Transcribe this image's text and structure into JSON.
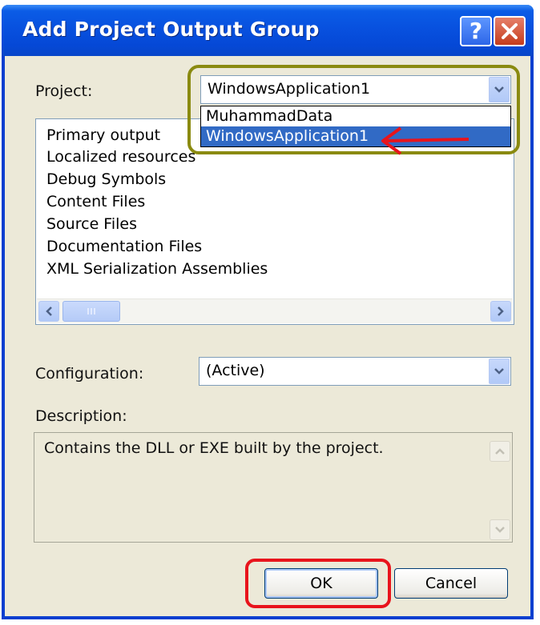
{
  "dialog": {
    "title": "Add Project Output Group",
    "help_symbol": "?",
    "close_symbol": "close"
  },
  "project": {
    "label": "Project:",
    "selected": "WindowsApplication1",
    "options": [
      "MuhammadData",
      "WindowsApplication1"
    ],
    "highlighted_index": 1
  },
  "outputs": {
    "items": [
      "Primary output",
      "Localized resources",
      "Debug Symbols",
      "Content Files",
      "Source Files",
      "Documentation Files",
      "XML Serialization Assemblies"
    ]
  },
  "configuration": {
    "label": "Configuration:",
    "value": "(Active)"
  },
  "description": {
    "label": "Description:",
    "text": "Contains the DLL or EXE built by the project."
  },
  "buttons": {
    "ok": "OK",
    "cancel": "Cancel"
  },
  "colors": {
    "title_bar": "#0851df",
    "selection": "#316ac5",
    "annotation_olive": "#8a8a10",
    "annotation_red": "#e8141c"
  }
}
